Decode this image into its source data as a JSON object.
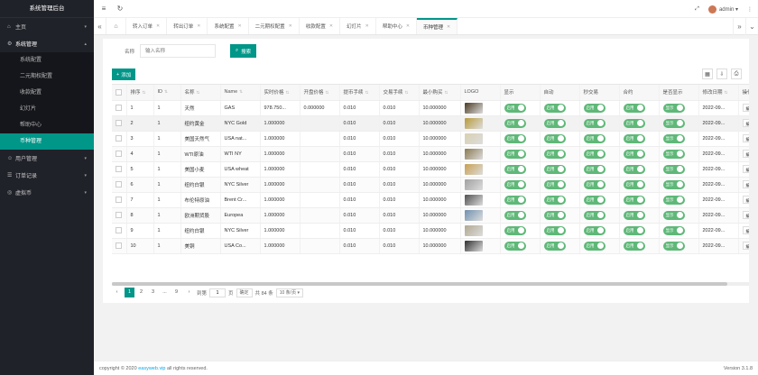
{
  "brand": "系统管理后台",
  "sidebar": {
    "items": [
      {
        "label": "主页",
        "icon": "home-icon"
      },
      {
        "label": "系统管理",
        "icon": "gear-icon",
        "open": true,
        "children": [
          "系统配置",
          "二元期权配置",
          "收款配置",
          "幻灯片",
          "帮助中心",
          "币种管理"
        ]
      },
      {
        "label": "用户管理",
        "icon": "user-icon"
      },
      {
        "label": "订单记录",
        "icon": "order-icon"
      },
      {
        "label": "虚拟币",
        "icon": "coin-icon"
      }
    ],
    "active_child": "币种管理"
  },
  "header": {
    "user": "admin",
    "menu_icon": "≡",
    "refresh_icon": "↻"
  },
  "tabs": [
    "转入订单",
    "转出订单",
    "系统配置",
    "二元期权配置",
    "收款配置",
    "幻灯片",
    "帮助中心",
    "币种管理"
  ],
  "active_tab": "币种管理",
  "search": {
    "label": "名称",
    "placeholder": "输入名称",
    "button": "搜索"
  },
  "add_button": "添加",
  "table": {
    "columns": [
      "",
      "排序",
      "ID",
      "名称",
      "Name",
      "实时价格",
      "开盘价格",
      "提币手续",
      "交易手续",
      "最小购买",
      "LOGO",
      "显示",
      "自动",
      "秒交易",
      "合约",
      "是否显示",
      "修改日期",
      "操作"
    ],
    "rows": [
      {
        "sort": "1",
        "id": "1",
        "name": "天然",
        "en": "GAS",
        "price": "978.750...",
        "open": "0.000000",
        "wfee": "0.010",
        "tfee": "0.010",
        "min": "10.000000",
        "logo": "#4a3a22",
        "date": "2022-09..."
      },
      {
        "sort": "2",
        "id": "1",
        "name": "纽约黄金",
        "en": "NYC Gold",
        "price": "1.000000",
        "open": "",
        "wfee": "0.010",
        "tfee": "0.010",
        "min": "10.000000",
        "logo": "#b89a3a",
        "date": "2022-09..."
      },
      {
        "sort": "3",
        "id": "1",
        "name": "美国天然气",
        "en": "USA nat...",
        "price": "1.000000",
        "open": "",
        "wfee": "0.010",
        "tfee": "0.010",
        "min": "10.000000",
        "logo": "#d8d0b0",
        "date": "2022-09..."
      },
      {
        "sort": "4",
        "id": "1",
        "name": "WTI原油",
        "en": "WTI NY",
        "price": "1.000000",
        "open": "",
        "wfee": "0.010",
        "tfee": "0.010",
        "min": "10.000000",
        "logo": "#8a7a50",
        "date": "2022-09..."
      },
      {
        "sort": "5",
        "id": "1",
        "name": "美国小麦",
        "en": "USA wheat",
        "price": "1.000000",
        "open": "",
        "wfee": "0.010",
        "tfee": "0.010",
        "min": "10.000000",
        "logo": "#c8a050",
        "date": "2022-09..."
      },
      {
        "sort": "6",
        "id": "1",
        "name": "纽约白银",
        "en": "NYC Silver",
        "price": "1.000000",
        "open": "",
        "wfee": "0.010",
        "tfee": "0.010",
        "min": "10.000000",
        "logo": "#a0a0a0",
        "date": "2022-09..."
      },
      {
        "sort": "7",
        "id": "1",
        "name": "布伦特原油",
        "en": "Brent Cr...",
        "price": "1.000000",
        "open": "",
        "wfee": "0.010",
        "tfee": "0.010",
        "min": "10.000000",
        "logo": "#505050",
        "date": "2022-09..."
      },
      {
        "sort": "8",
        "id": "1",
        "name": "欧洲期货股",
        "en": "Europea",
        "price": "1.000000",
        "open": "",
        "wfee": "0.010",
        "tfee": "0.010",
        "min": "10.000000",
        "logo": "#7090b0",
        "date": "2022-09..."
      },
      {
        "sort": "9",
        "id": "1",
        "name": "纽约白银",
        "en": "NYC Silver",
        "price": "1.000000",
        "open": "",
        "wfee": "0.010",
        "tfee": "0.010",
        "min": "10.000000",
        "logo": "#b0a890",
        "date": "2022-09..."
      },
      {
        "sort": "10",
        "id": "1",
        "name": "美铜",
        "en": "USA Co...",
        "price": "1.000000",
        "open": "",
        "wfee": "0.010",
        "tfee": "0.010",
        "min": "10.000000",
        "logo": "#303030",
        "date": "2022-09..."
      }
    ],
    "switch_labels": [
      "启用",
      "启用",
      "启用",
      "启用",
      "显示"
    ],
    "op_label": "编"
  },
  "pager": {
    "pages": [
      "1",
      "2",
      "3",
      "...",
      "9"
    ],
    "active": "1",
    "goto_label": "到第",
    "goto_value": "1",
    "page_unit": "页",
    "confirm": "确定",
    "total": "共 84 条",
    "per_page": "10 条/页"
  },
  "footer": {
    "copyright_prefix": "copyright © 2020",
    "site": "easyweb.vip",
    "copyright_suffix": "all rights reserved.",
    "version": "Version 3.1.8"
  }
}
